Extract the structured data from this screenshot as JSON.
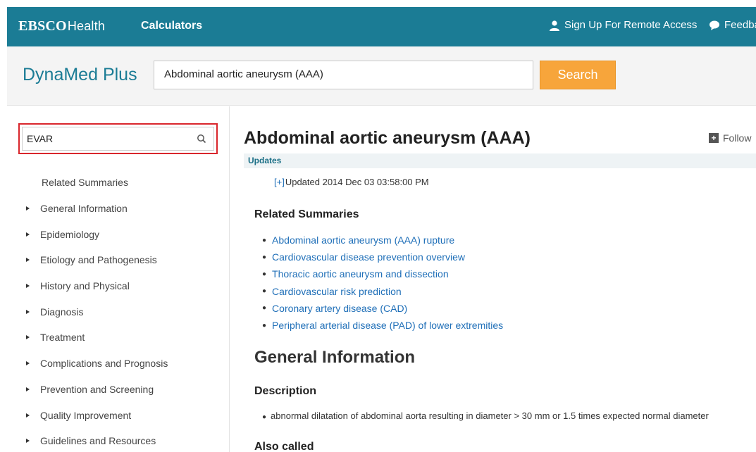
{
  "topbar": {
    "brand_bold": "EBSCO",
    "brand_thin": "Health",
    "calculators": "Calculators",
    "signup": "Sign Up For Remote Access",
    "feedback": "Feedback",
    "color": "#1b7c95"
  },
  "search": {
    "logo": "DynaMed Plus",
    "query": "Abdominal aortic aneurysm (AAA)",
    "button": "Search",
    "button_color": "#f7a53b"
  },
  "sidebar": {
    "search_value": "EVAR",
    "search_highlight_color": "#d9262c",
    "items": [
      {
        "label": "Related Summaries",
        "bullet": false
      },
      {
        "label": "General Information",
        "bullet": true
      },
      {
        "label": "Epidemiology",
        "bullet": true
      },
      {
        "label": "Etiology and Pathogenesis",
        "bullet": true
      },
      {
        "label": "History and Physical",
        "bullet": true
      },
      {
        "label": "Diagnosis",
        "bullet": true
      },
      {
        "label": "Treatment",
        "bullet": true
      },
      {
        "label": "Complications and Prognosis",
        "bullet": true
      },
      {
        "label": "Prevention and Screening",
        "bullet": true
      },
      {
        "label": "Quality Improvement",
        "bullet": true
      },
      {
        "label": "Guidelines and Resources",
        "bullet": true
      }
    ]
  },
  "main": {
    "title": "Abdominal aortic aneurysm (AAA)",
    "follow": "Follow",
    "updates_label": "Updates",
    "updated_prefix": "[+]",
    "updated_text": "Updated 2014 Dec 03 03:58:00 PM",
    "related_heading": "Related Summaries",
    "related": [
      "Abdominal aortic aneurysm (AAA) rupture",
      "Cardiovascular disease prevention overview",
      "Thoracic aortic aneurysm and dissection",
      "Cardiovascular risk prediction",
      "Coronary artery disease (CAD)",
      "Peripheral arterial disease (PAD) of lower extremities"
    ],
    "general_heading": "General Information",
    "description_heading": "Description",
    "description_item": "abnormal dilatation of abdominal aorta resulting in diameter > 30 mm or 1.5 times expected normal diameter",
    "also_called_heading": "Also called",
    "link_color": "#1f6fb8"
  }
}
